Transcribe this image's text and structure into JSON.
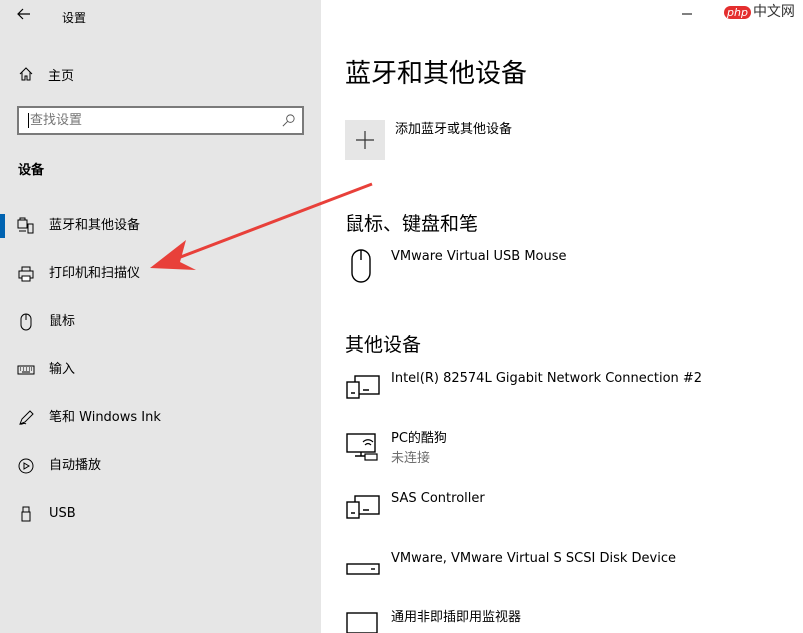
{
  "app": {
    "title": "设置",
    "back_icon": "back-arrow-icon"
  },
  "sidebar": {
    "home_label": "主页",
    "search": {
      "placeholder": "查找设置"
    },
    "section_label": "设备",
    "items": [
      {
        "label": "蓝牙和其他设备",
        "icon": "bluetooth-icon",
        "selected": true
      },
      {
        "label": "打印机和扫描仪",
        "icon": "printer-icon",
        "selected": false
      },
      {
        "label": "鼠标",
        "icon": "mouse-icon",
        "selected": false
      },
      {
        "label": "输入",
        "icon": "keyboard-icon",
        "selected": false
      },
      {
        "label": "笔和 Windows Ink",
        "icon": "pen-icon",
        "selected": false
      },
      {
        "label": "自动播放",
        "icon": "autoplay-icon",
        "selected": false
      },
      {
        "label": "USB",
        "icon": "usb-icon",
        "selected": false
      }
    ]
  },
  "main": {
    "title": "蓝牙和其他设备",
    "add_label": "添加蓝牙或其他设备",
    "mouse_section": {
      "title": "鼠标、键盘和笔",
      "devices": [
        {
          "name": "VMware Virtual USB Mouse",
          "icon": "mouse-device-icon"
        }
      ]
    },
    "other_section": {
      "title": "其他设备",
      "devices": [
        {
          "name": "Intel(R) 82574L Gigabit Network Connection #2",
          "icon": "generic-device-icon"
        },
        {
          "name": "PC的酷狗",
          "status": "未连接",
          "icon": "network-device-icon"
        },
        {
          "name": "SAS Controller",
          "icon": "generic-device-icon"
        },
        {
          "name": "VMware, VMware Virtual S SCSI Disk Device",
          "icon": "drive-icon"
        },
        {
          "name": "通用非即插即用监视器",
          "icon": "monitor-icon"
        }
      ]
    }
  },
  "watermark": {
    "php": "php",
    "cn": "中文网"
  },
  "colors": {
    "accent": "#0063b1",
    "sidebar_bg": "#e6e6e6",
    "annotation_arrow": "#e8403a"
  }
}
